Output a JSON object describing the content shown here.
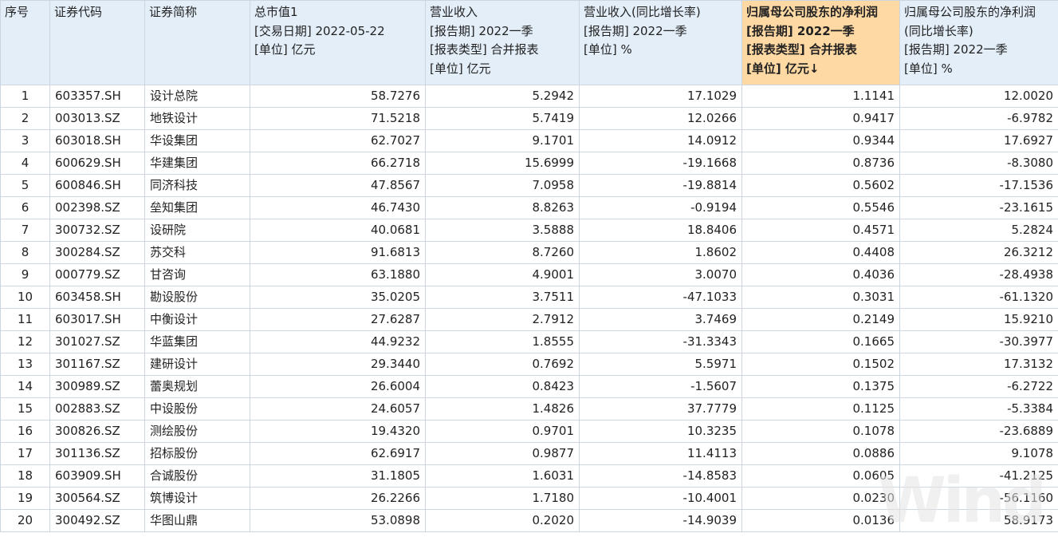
{
  "header": {
    "seq": "序号",
    "code": "证券代码",
    "name": "证券简称",
    "mktcap": [
      "总市值1",
      "[交易日期] 2022-05-22",
      "[单位] 亿元"
    ],
    "revenue": [
      "营业收入",
      "[报告期] 2022一季",
      "[报表类型] 合并报表",
      "[单位] 亿元"
    ],
    "revenue_yoy": [
      "营业收入(同比增长率)",
      "[报告期] 2022一季",
      "[单位] %"
    ],
    "netprofit": [
      "归属母公司股东的净利润",
      "[报告期] 2022一季",
      "[报表类型] 合并报表",
      "[单位] 亿元↓"
    ],
    "netprofit_yoy": [
      "归属母公司股东的净利润",
      "(同比增长率)",
      "[报告期] 2022一季",
      "[单位] %"
    ]
  },
  "rows": [
    [
      "1",
      "603357.SH",
      "设计总院",
      "58.7276",
      "5.2942",
      "17.1029",
      "1.1141",
      "12.0020"
    ],
    [
      "2",
      "003013.SZ",
      "地铁设计",
      "71.5218",
      "5.7419",
      "12.0266",
      "0.9417",
      "-6.9782"
    ],
    [
      "3",
      "603018.SH",
      "华设集团",
      "62.7027",
      "9.1701",
      "14.0912",
      "0.9344",
      "17.6927"
    ],
    [
      "4",
      "600629.SH",
      "华建集团",
      "66.2718",
      "15.6999",
      "-19.1668",
      "0.8736",
      "-8.3080"
    ],
    [
      "5",
      "600846.SH",
      "同济科技",
      "47.8567",
      "7.0958",
      "-19.8814",
      "0.5602",
      "-17.1536"
    ],
    [
      "6",
      "002398.SZ",
      "垒知集团",
      "46.7430",
      "8.8263",
      "-0.9194",
      "0.5546",
      "-23.1615"
    ],
    [
      "7",
      "300732.SZ",
      "设研院",
      "40.0681",
      "3.5888",
      "18.8406",
      "0.4571",
      "5.2824"
    ],
    [
      "8",
      "300284.SZ",
      "苏交科",
      "91.6813",
      "8.7260",
      "1.8602",
      "0.4408",
      "26.3212"
    ],
    [
      "9",
      "000779.SZ",
      "甘咨询",
      "63.1880",
      "4.9001",
      "3.0070",
      "0.4036",
      "-28.4938"
    ],
    [
      "10",
      "603458.SH",
      "勘设股份",
      "35.0205",
      "3.7511",
      "-47.1033",
      "0.3031",
      "-61.1320"
    ],
    [
      "11",
      "603017.SH",
      "中衡设计",
      "27.6287",
      "2.7912",
      "3.7469",
      "0.2149",
      "15.9210"
    ],
    [
      "12",
      "301027.SZ",
      "华蓝集团",
      "44.9232",
      "1.8555",
      "-31.3343",
      "0.1665",
      "-30.3977"
    ],
    [
      "13",
      "301167.SZ",
      "建研设计",
      "29.3440",
      "0.7692",
      "5.5971",
      "0.1502",
      "17.3132"
    ],
    [
      "14",
      "300989.SZ",
      "蕾奥规划",
      "26.6004",
      "0.8423",
      "-1.5607",
      "0.1375",
      "-6.2722"
    ],
    [
      "15",
      "002883.SZ",
      "中设股份",
      "24.6057",
      "1.4826",
      "37.7779",
      "0.1125",
      "-5.3384"
    ],
    [
      "16",
      "300826.SZ",
      "测绘股份",
      "19.4320",
      "0.9701",
      "10.3235",
      "0.1078",
      "-23.6889"
    ],
    [
      "17",
      "301136.SZ",
      "招标股份",
      "62.6917",
      "0.9877",
      "11.4113",
      "0.0886",
      "9.1078"
    ],
    [
      "18",
      "603909.SH",
      "合诚股份",
      "31.1805",
      "1.6031",
      "-14.8583",
      "0.0605",
      "-41.2125"
    ],
    [
      "19",
      "300564.SZ",
      "筑博设计",
      "26.2266",
      "1.7180",
      "-10.4001",
      "0.0230",
      "-56.1160"
    ],
    [
      "20",
      "300492.SZ",
      "华图山鼎",
      "53.0898",
      "0.2020",
      "-14.9039",
      "0.0136",
      "58.9173"
    ]
  ],
  "watermark": "Wind"
}
